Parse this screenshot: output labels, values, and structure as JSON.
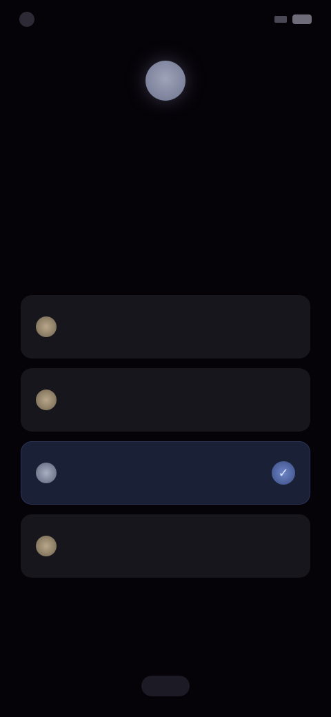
{
  "status_bar": {
    "time": "",
    "left_icon": "app-dot-icon",
    "right_icons": [
      "signal-icon",
      "battery-icon"
    ]
  },
  "header": {
    "icon": "avatar-orb-icon",
    "title": ""
  },
  "options": [
    {
      "label": "",
      "icon": "option-dot-icon",
      "selected": false
    },
    {
      "label": "",
      "icon": "option-dot-icon",
      "selected": false
    },
    {
      "label": "",
      "icon": "option-dot-icon",
      "selected": true
    },
    {
      "label": "",
      "icon": "option-dot-icon",
      "selected": false
    }
  ],
  "selected_indicator_icon": "checkmark-icon",
  "footer": {
    "button_label": ""
  },
  "colors": {
    "background": "#050208",
    "card": "#17161d",
    "card_selected": "#1a2035",
    "accent": "#6e86c8"
  }
}
